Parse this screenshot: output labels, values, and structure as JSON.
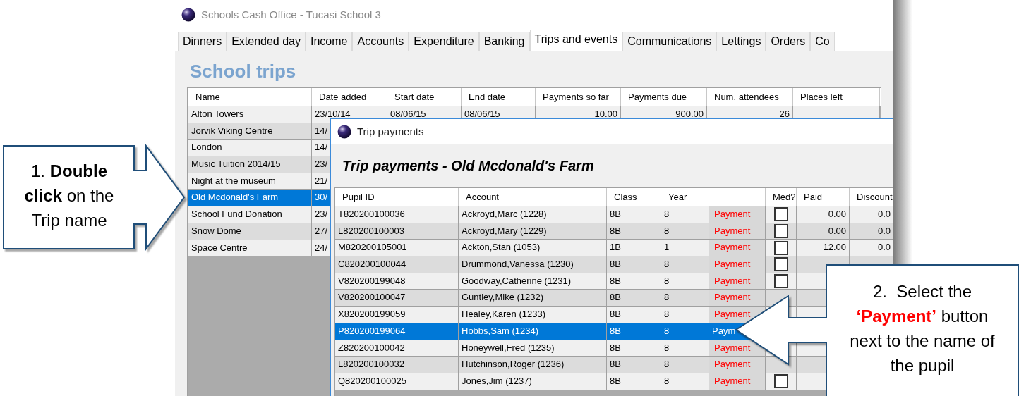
{
  "window": {
    "title": "Schools Cash Office - Tucasi School 3"
  },
  "tabs": [
    {
      "label": "Dinners",
      "selected": false
    },
    {
      "label": "Extended day",
      "selected": false
    },
    {
      "label": "Income",
      "selected": false
    },
    {
      "label": "Accounts",
      "selected": false
    },
    {
      "label": "Expenditure",
      "selected": false
    },
    {
      "label": "Banking",
      "selected": false
    },
    {
      "label": "Trips and events",
      "selected": true
    },
    {
      "label": "Communications",
      "selected": false
    },
    {
      "label": "Lettings",
      "selected": false
    },
    {
      "label": "Orders",
      "selected": false
    },
    {
      "label": "Co",
      "selected": false
    }
  ],
  "heading": "School trips",
  "trips_table": {
    "columns": [
      "Name",
      "Date added",
      "Start date",
      "End date",
      "Payments so far",
      "Payments due",
      "Num. attendees",
      "Places left"
    ],
    "rows": [
      {
        "cells": [
          "Alton Towers",
          "23/10/14",
          "08/06/15",
          "08/06/15",
          "10.00",
          "900.00",
          "26"
        ],
        "selected": false
      },
      {
        "cells": [
          "Jorvik Viking Centre",
          "14/"
        ],
        "selected": false
      },
      {
        "cells": [
          "London",
          "14/"
        ],
        "selected": false
      },
      {
        "cells": [
          "Music Tuition 2014/15",
          "23/"
        ],
        "selected": false
      },
      {
        "cells": [
          "Night at the museum",
          "21/"
        ],
        "selected": false
      },
      {
        "cells": [
          "Old Mcdonald's Farm",
          "30/"
        ],
        "selected": true
      },
      {
        "cells": [
          "School Fund Donation",
          "23/"
        ],
        "selected": false
      },
      {
        "cells": [
          "Snow Dome",
          "27/"
        ],
        "selected": false
      },
      {
        "cells": [
          "Space Centre",
          "24/"
        ],
        "selected": false
      }
    ]
  },
  "dialog": {
    "title": "Trip payments",
    "heading": "Trip payments - Old Mcdonald's Farm",
    "columns": [
      "Pupil ID",
      "Account",
      "Class",
      "Year",
      "Med?",
      "Paid",
      "Discount"
    ],
    "rows": [
      {
        "pupil_id": "T820200100036",
        "account": "Ackroyd,Marc (1228)",
        "class": "8B",
        "year": "8",
        "payment": "Payment",
        "med_checked": false,
        "paid": "0.00",
        "discount": "0.0",
        "selected": false
      },
      {
        "pupil_id": "L820200100003",
        "account": "Ackroyd,Mary (1229)",
        "class": "8B",
        "year": "8",
        "payment": "Payment",
        "med_checked": false,
        "paid": "0.00",
        "discount": "0.0",
        "selected": false
      },
      {
        "pupil_id": "M820200105001",
        "account": "Ackton,Stan (1053)",
        "class": "1B",
        "year": "1",
        "payment": "Payment",
        "med_checked": false,
        "paid": "12.00",
        "discount": "0.0",
        "selected": false
      },
      {
        "pupil_id": "C820200100044",
        "account": "Drummond,Vanessa (1230)",
        "class": "8B",
        "year": "8",
        "payment": "Payment",
        "med_checked": false,
        "selected": false
      },
      {
        "pupil_id": "V820200199048",
        "account": "Goodway,Catherine (1231)",
        "class": "8B",
        "year": "8",
        "payment": "Payment",
        "med_checked": false,
        "selected": false
      },
      {
        "pupil_id": "V820200100047",
        "account": "Guntley,Mike (1232)",
        "class": "8B",
        "year": "8",
        "payment": "Payment",
        "selected": false
      },
      {
        "pupil_id": "X820200199059",
        "account": "Healey,Karen (1233)",
        "class": "8B",
        "year": "8",
        "payment": "Payment",
        "selected": false
      },
      {
        "pupil_id": "P820200199064",
        "account": "Hobbs,Sam (1234)",
        "class": "8B",
        "year": "8",
        "payment": "Paym",
        "selected": true
      },
      {
        "pupil_id": "Z820200100042",
        "account": "Honeywell,Fred (1235)",
        "class": "8B",
        "year": "8",
        "payment": "Payment",
        "selected": false
      },
      {
        "pupil_id": "L820200100032",
        "account": "Hutchinson,Roger (1236)",
        "class": "8B",
        "year": "8",
        "payment": "Payment",
        "selected": false
      },
      {
        "pupil_id": "Q820200100025",
        "account": "Jones,Jim (1237)",
        "class": "8B",
        "year": "8",
        "payment": "Payment",
        "med_checked": false,
        "selected": false
      }
    ]
  },
  "callouts": [
    {
      "text": "1. **Double click** on the Trip name"
    },
    {
      "text": "2.  Select the **‘Payment’** button next to the name of the pupil"
    }
  ]
}
